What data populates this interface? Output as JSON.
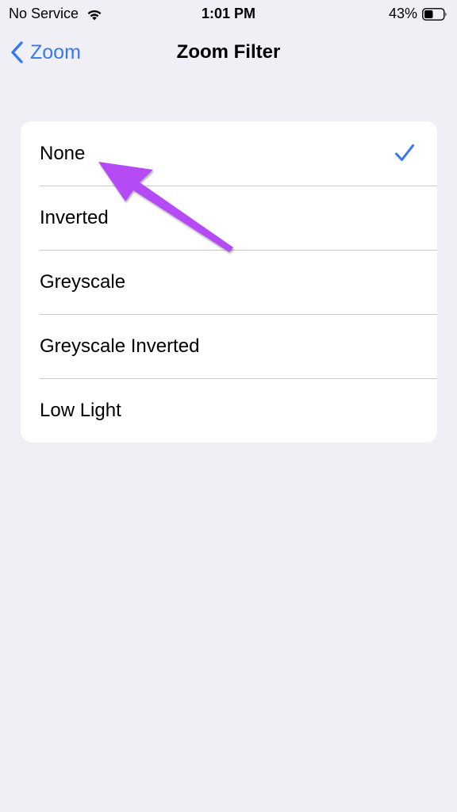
{
  "status_bar": {
    "carrier": "No Service",
    "time": "1:01 PM",
    "battery_percent": "43%",
    "icons": [
      "wifi-icon",
      "battery-icon"
    ]
  },
  "nav": {
    "back_label": "Zoom",
    "title": "Zoom Filter"
  },
  "filter_options": [
    {
      "label": "None",
      "selected": true
    },
    {
      "label": "Inverted",
      "selected": false
    },
    {
      "label": "Greyscale",
      "selected": false
    },
    {
      "label": "Greyscale Inverted",
      "selected": false
    },
    {
      "label": "Low Light",
      "selected": false
    }
  ],
  "colors": {
    "accent": "#3478f6",
    "background": "#f0eff5",
    "annotation_arrow": "#b44cf5"
  }
}
